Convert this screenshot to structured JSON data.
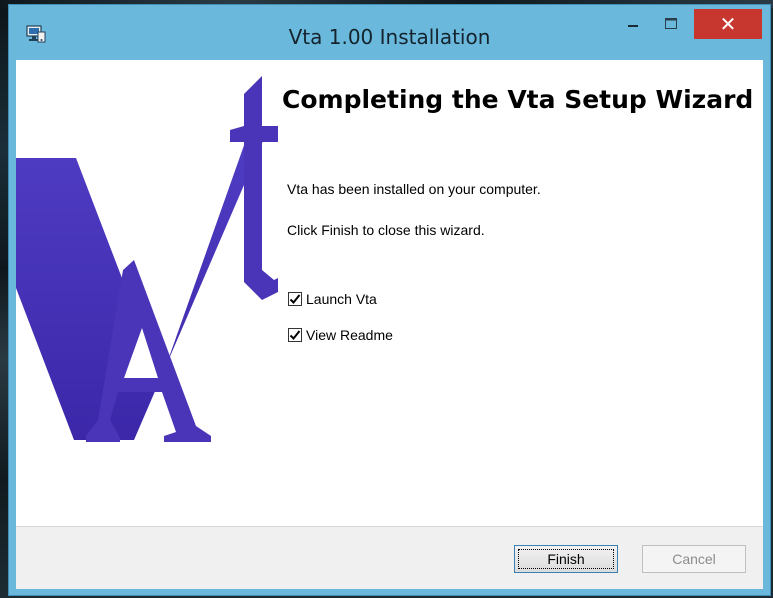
{
  "window": {
    "title": "Vta 1.00 Installation",
    "accent_color": "#6ab8dc",
    "close_color": "#c7372f",
    "icons": {
      "app": "installer-icon",
      "minimize": "minimize-icon",
      "maximize": "maximize-icon",
      "close": "close-icon"
    },
    "close_glyph": "✕"
  },
  "wizard": {
    "heading": "Completing the Vta Setup Wizard",
    "line1": "Vta has been installed on your computer.",
    "line2": "Click Finish to close this wizard.",
    "logo": {
      "icon": "vta-logo",
      "color": "#4a35b8",
      "letters": [
        "V",
        "t",
        "A"
      ]
    },
    "options": [
      {
        "label": "Launch Vta",
        "checked": true
      },
      {
        "label": "View Readme",
        "checked": true
      }
    ]
  },
  "footer": {
    "finish_label": "Finish",
    "cancel_label": "Cancel",
    "cancel_enabled": false
  }
}
